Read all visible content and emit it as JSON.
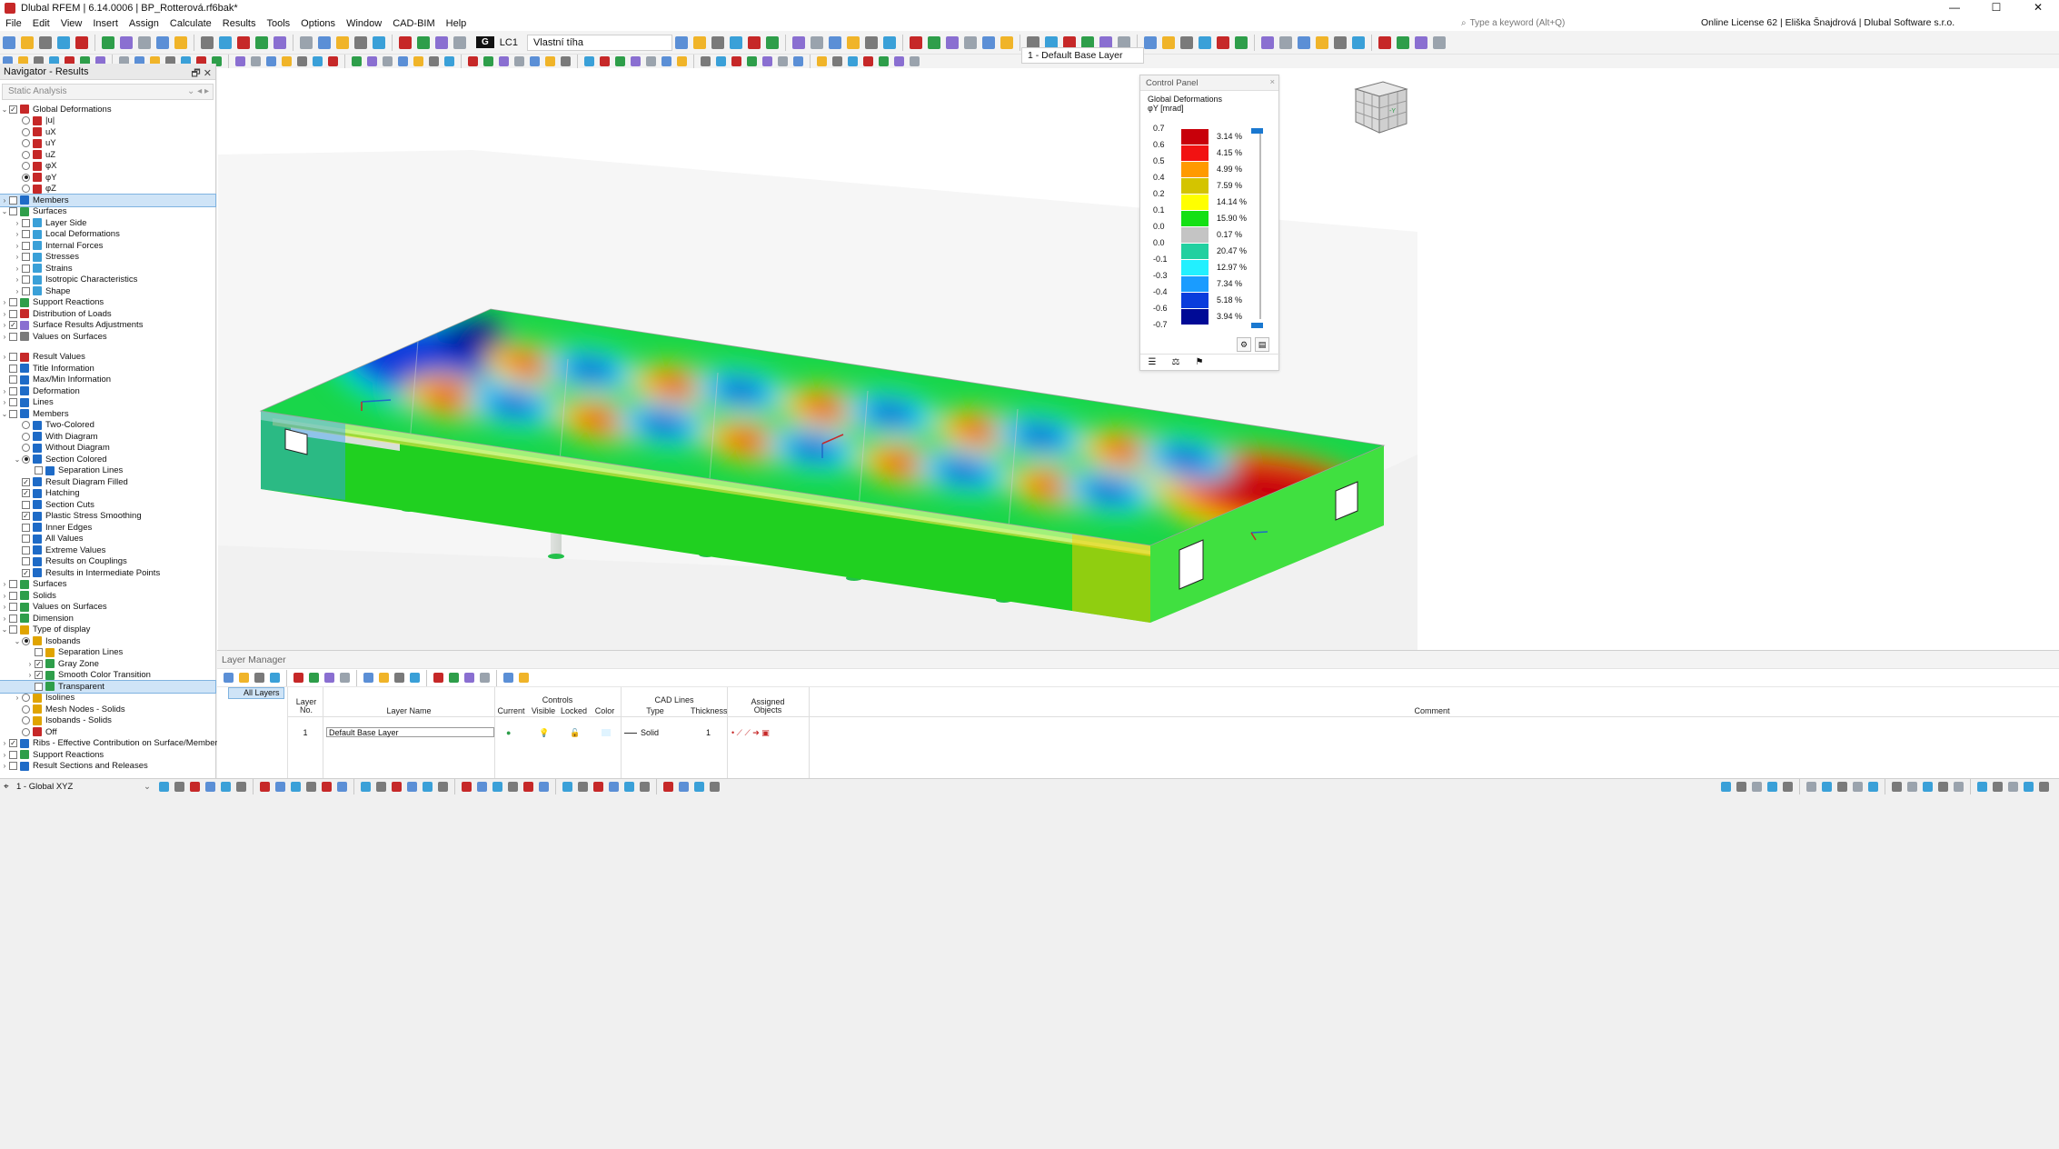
{
  "window": {
    "title": "Dlubal RFEM | 6.14.0006 | BP_Rotterová.rf6bak*",
    "controls": [
      "—",
      "☐",
      "✕"
    ]
  },
  "menu": {
    "items": [
      "File",
      "Edit",
      "View",
      "Insert",
      "Assign",
      "Calculate",
      "Results",
      "Tools",
      "Options",
      "Window",
      "CAD-BIM",
      "Help"
    ],
    "search_placeholder": "Type a keyword (Alt+Q)",
    "license": "Online License 62 | Eliška Šnajdrová | Dlubal Software s.r.o."
  },
  "toolbar": {
    "load_case_tag": "G",
    "load_case_id": "LC1",
    "load_case_name": "Vlastní tíha",
    "layer": "1 - Default Base Layer"
  },
  "navigator": {
    "title": "Navigator - Results",
    "header_buttons": "🗗  ✕",
    "dropdown": "Static Analysis",
    "rows1": [
      {
        "label": "Global Deformations",
        "lvl": 0,
        "exp": "v",
        "ctl": "chk",
        "on": true,
        "icon": "#c62828"
      },
      {
        "label": "|u|",
        "lvl": 1,
        "ctl": "rad",
        "on": false,
        "icon": "#c62828"
      },
      {
        "label": "uX",
        "lvl": 1,
        "ctl": "rad",
        "on": false,
        "icon": "#c62828"
      },
      {
        "label": "uY",
        "lvl": 1,
        "ctl": "rad",
        "on": false,
        "icon": "#c62828"
      },
      {
        "label": "uZ",
        "lvl": 1,
        "ctl": "rad",
        "on": false,
        "icon": "#c62828"
      },
      {
        "label": "φX",
        "lvl": 1,
        "ctl": "rad",
        "on": false,
        "icon": "#c62828"
      },
      {
        "label": "φY",
        "lvl": 1,
        "ctl": "rad",
        "on": true,
        "icon": "#c62828"
      },
      {
        "label": "φZ",
        "lvl": 1,
        "ctl": "rad",
        "on": false,
        "icon": "#c62828"
      },
      {
        "label": "Members",
        "lvl": 0,
        "exp": ">",
        "ctl": "chk",
        "on": false,
        "icon": "#1e6bc7",
        "sel": true
      },
      {
        "label": "Surfaces",
        "lvl": 0,
        "exp": "v",
        "ctl": "chk",
        "on": false,
        "icon": "#2e9e4a"
      },
      {
        "label": "Layer Side",
        "lvl": 1,
        "exp": ">",
        "ctl": "chk",
        "on": false,
        "icon": "#3aa0d8"
      },
      {
        "label": "Local Deformations",
        "lvl": 1,
        "exp": ">",
        "ctl": "chk",
        "on": false,
        "icon": "#3aa0d8"
      },
      {
        "label": "Internal Forces",
        "lvl": 1,
        "exp": ">",
        "ctl": "chk",
        "on": false,
        "icon": "#3aa0d8"
      },
      {
        "label": "Stresses",
        "lvl": 1,
        "exp": ">",
        "ctl": "chk",
        "on": false,
        "icon": "#3aa0d8"
      },
      {
        "label": "Strains",
        "lvl": 1,
        "exp": ">",
        "ctl": "chk",
        "on": false,
        "icon": "#3aa0d8"
      },
      {
        "label": "Isotropic Characteristics",
        "lvl": 1,
        "exp": ">",
        "ctl": "chk",
        "on": false,
        "icon": "#3aa0d8"
      },
      {
        "label": "Shape",
        "lvl": 1,
        "exp": ">",
        "ctl": "chk",
        "on": false,
        "icon": "#3aa0d8"
      },
      {
        "label": "Support Reactions",
        "lvl": 0,
        "exp": ">",
        "ctl": "chk",
        "on": false,
        "icon": "#2e9e4a"
      },
      {
        "label": "Distribution of Loads",
        "lvl": 0,
        "exp": ">",
        "ctl": "chk",
        "on": false,
        "icon": "#c62828"
      },
      {
        "label": "Surface Results Adjustments",
        "lvl": 0,
        "exp": ">",
        "ctl": "chk",
        "on": true,
        "icon": "#8a6fd1"
      },
      {
        "label": "Values on Surfaces",
        "lvl": 0,
        "exp": ">",
        "ctl": "chk",
        "on": false,
        "icon": "#7a7a7a"
      }
    ],
    "rows2": [
      {
        "label": "Result Values",
        "lvl": 0,
        "exp": ">",
        "ctl": "chk",
        "on": false,
        "icon": "#c62828"
      },
      {
        "label": "Title Information",
        "lvl": 0,
        "ctl": "chk",
        "on": false,
        "icon": "#1e6bc7"
      },
      {
        "label": "Max/Min Information",
        "lvl": 0,
        "ctl": "chk",
        "on": false,
        "icon": "#1e6bc7"
      },
      {
        "label": "Deformation",
        "lvl": 0,
        "exp": ">",
        "ctl": "chk",
        "on": false,
        "icon": "#1e6bc7"
      },
      {
        "label": "Lines",
        "lvl": 0,
        "exp": ">",
        "ctl": "chk",
        "on": false,
        "icon": "#1e6bc7"
      },
      {
        "label": "Members",
        "lvl": 0,
        "exp": "v",
        "ctl": "chk",
        "on": false,
        "icon": "#1e6bc7"
      },
      {
        "label": "Two-Colored",
        "lvl": 1,
        "ctl": "rad",
        "on": false,
        "icon": "#1e6bc7"
      },
      {
        "label": "With Diagram",
        "lvl": 1,
        "ctl": "rad",
        "on": false,
        "icon": "#1e6bc7"
      },
      {
        "label": "Without Diagram",
        "lvl": 1,
        "ctl": "rad",
        "on": false,
        "icon": "#1e6bc7"
      },
      {
        "label": "Section Colored",
        "lvl": 1,
        "exp": "v",
        "ctl": "rad",
        "on": true,
        "icon": "#1e6bc7"
      },
      {
        "label": "Separation Lines",
        "lvl": 2,
        "ctl": "chk",
        "on": false,
        "icon": "#1e6bc7"
      },
      {
        "label": "Result Diagram Filled",
        "lvl": 1,
        "ctl": "chk",
        "on": true,
        "icon": "#1e6bc7"
      },
      {
        "label": "Hatching",
        "lvl": 1,
        "ctl": "chk",
        "on": true,
        "icon": "#1e6bc7"
      },
      {
        "label": "Section Cuts",
        "lvl": 1,
        "ctl": "chk",
        "on": false,
        "icon": "#1e6bc7"
      },
      {
        "label": "Plastic Stress Smoothing",
        "lvl": 1,
        "ctl": "chk",
        "on": true,
        "icon": "#1e6bc7"
      },
      {
        "label": "Inner Edges",
        "lvl": 1,
        "ctl": "chk",
        "on": false,
        "icon": "#1e6bc7"
      },
      {
        "label": "All Values",
        "lvl": 1,
        "ctl": "chk",
        "on": false,
        "icon": "#1e6bc7"
      },
      {
        "label": "Extreme Values",
        "lvl": 1,
        "ctl": "chk",
        "on": false,
        "icon": "#1e6bc7"
      },
      {
        "label": "Results on Couplings",
        "lvl": 1,
        "ctl": "chk",
        "on": false,
        "icon": "#1e6bc7"
      },
      {
        "label": "Results in Intermediate Points",
        "lvl": 1,
        "ctl": "chk",
        "on": true,
        "icon": "#1e6bc7"
      },
      {
        "label": "Surfaces",
        "lvl": 0,
        "exp": ">",
        "ctl": "chk",
        "on": false,
        "icon": "#2e9e4a"
      },
      {
        "label": "Solids",
        "lvl": 0,
        "exp": ">",
        "ctl": "chk",
        "on": false,
        "icon": "#2e9e4a"
      },
      {
        "label": "Values on Surfaces",
        "lvl": 0,
        "exp": ">",
        "ctl": "chk",
        "on": false,
        "icon": "#2e9e4a"
      },
      {
        "label": "Dimension",
        "lvl": 0,
        "exp": ">",
        "ctl": "chk",
        "on": false,
        "icon": "#2e9e4a"
      },
      {
        "label": "Type of display",
        "lvl": 0,
        "exp": "v",
        "ctl": "chk",
        "on": false,
        "icon": "#e0a400"
      },
      {
        "label": "Isobands",
        "lvl": 1,
        "exp": "v",
        "ctl": "rad",
        "on": true,
        "icon": "#e0a400"
      },
      {
        "label": "Separation Lines",
        "lvl": 2,
        "ctl": "chk",
        "on": false,
        "icon": "#e0a400"
      },
      {
        "label": "Gray Zone",
        "lvl": 2,
        "exp": ">",
        "ctl": "chk",
        "on": true,
        "icon": "#2e9e4a"
      },
      {
        "label": "Smooth Color Transition",
        "lvl": 2,
        "exp": ">",
        "ctl": "chk",
        "on": true,
        "icon": "#2e9e4a"
      },
      {
        "label": "Transparent",
        "lvl": 2,
        "ctl": "chk",
        "on": false,
        "icon": "#2e9e4a",
        "sel": true
      },
      {
        "label": "Isolines",
        "lvl": 1,
        "exp": ">",
        "ctl": "rad",
        "on": false,
        "icon": "#e0a400"
      },
      {
        "label": "Mesh Nodes - Solids",
        "lvl": 1,
        "ctl": "rad",
        "on": false,
        "icon": "#e0a400"
      },
      {
        "label": "Isobands - Solids",
        "lvl": 1,
        "ctl": "rad",
        "on": false,
        "icon": "#e0a400"
      },
      {
        "label": "Off",
        "lvl": 1,
        "ctl": "rad",
        "on": false,
        "icon": "#c62828"
      },
      {
        "label": "Ribs - Effective Contribution on Surface/Member",
        "lvl": 0,
        "exp": ">",
        "ctl": "chk",
        "on": true,
        "icon": "#1e6bc7"
      },
      {
        "label": "Support Reactions",
        "lvl": 0,
        "exp": ">",
        "ctl": "chk",
        "on": false,
        "icon": "#2e9e4a"
      },
      {
        "label": "Result Sections and Releases",
        "lvl": 0,
        "exp": ">",
        "ctl": "chk",
        "on": false,
        "icon": "#1e6bc7"
      }
    ]
  },
  "control_panel": {
    "title": "Control Panel",
    "close": "×",
    "heading": "Global Deformations",
    "unit": "φY [mrad]",
    "legend": {
      "values": [
        "0.7",
        "0.6",
        "0.5",
        "0.4",
        "0.2",
        "0.1",
        "0.0",
        "0.0",
        "-0.1",
        "-0.3",
        "-0.4",
        "-0.6"
      ],
      "last_value": "-0.7",
      "colors": [
        "#c8000a",
        "#f21212",
        "#ff9a00",
        "#d4c400",
        "#ffff00",
        "#14e014",
        "#c4c4c4",
        "#22d0a0",
        "#22f0ff",
        "#1a9cff",
        "#0a3cdc",
        "#000a96"
      ],
      "percents": [
        "3.14 %",
        "4.15 %",
        "4.99 %",
        "7.59 %",
        "14.14 %",
        "15.90 %",
        "0.17 %",
        "20.47 %",
        "12.97 %",
        "7.34 %",
        "5.18 %",
        "3.94 %"
      ]
    }
  },
  "layer_manager": {
    "title": "Layer Manager",
    "all_layers": "All Layers",
    "headers": {
      "layer_no": "Layer\nNo.",
      "layer_name": "Layer Name",
      "controls": "Controls",
      "current": "Current",
      "visible": "Visible",
      "locked": "Locked",
      "color": "Color",
      "cad_lines": "CAD Lines",
      "type": "Type",
      "thickness": "Thickness",
      "assigned": "Assigned\nObjects",
      "comment": "Comment"
    },
    "rows": [
      {
        "no": "1",
        "name": "Default Base Layer",
        "line_type": "Solid",
        "thickness": "1"
      }
    ]
  },
  "statusbar": {
    "coordinate_system": "1 - Global XYZ"
  }
}
